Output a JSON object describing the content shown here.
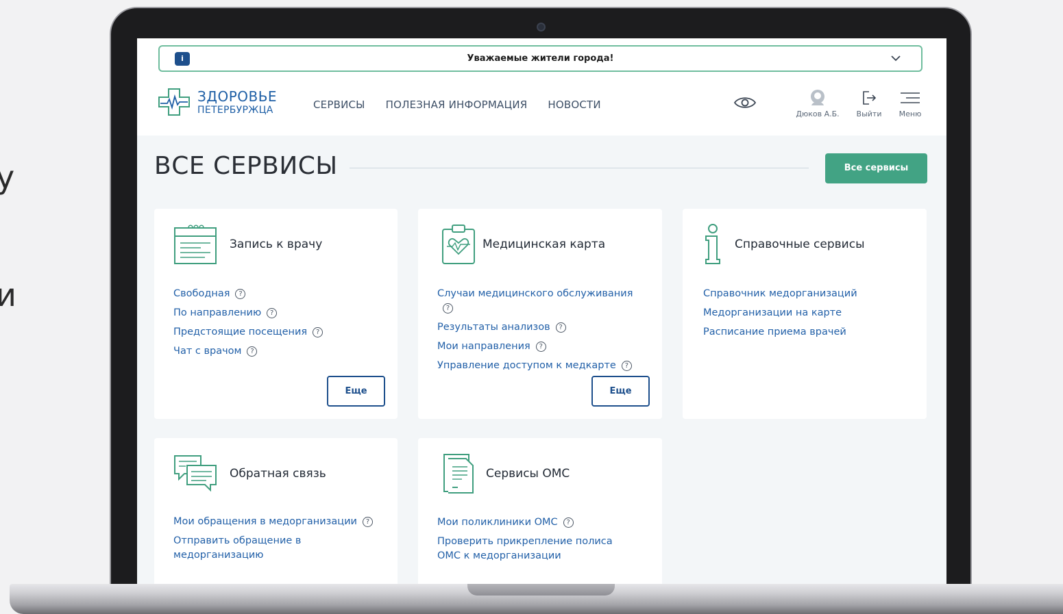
{
  "left_glyphs": [
    "у",
    "и"
  ],
  "alert": {
    "badge": "i",
    "text": "Уважаемые жители города!"
  },
  "logo": {
    "line1": "ЗДОРОВЬЕ",
    "line2": "ПЕТЕРБУРЖЦА"
  },
  "nav": [
    "СЕРВИСЫ",
    "ПОЛЕЗНАЯ ИНФОРМАЦИЯ",
    "НОВОСТИ"
  ],
  "header_actions": {
    "user": "Дюков А.Б.",
    "exit": "Выйти",
    "menu": "Меню"
  },
  "page": {
    "title": "ВСЕ СЕРВИСЫ",
    "all_services_button": "Все сервисы"
  },
  "cards": [
    {
      "title": "Запись к врачу",
      "icon": "calendar-icon",
      "links": [
        {
          "label": "Свободная",
          "help": true
        },
        {
          "label": "По направлению",
          "help": true
        },
        {
          "label": "Предстоящие посещения",
          "help": true
        },
        {
          "label": "Чат с врачом",
          "help": true
        }
      ],
      "more": "Еще"
    },
    {
      "title": "Медицинская карта",
      "icon": "medical-card-icon",
      "links": [
        {
          "label": "Случаи медицинского обслуживания",
          "help": true
        },
        {
          "label": "Результаты анализов",
          "help": true
        },
        {
          "label": "Мои направления",
          "help": true
        },
        {
          "label": "Управление доступом к медкарте",
          "help": true
        }
      ],
      "more": "Еще"
    },
    {
      "title": "Справочные сервисы",
      "icon": "info-icon",
      "links": [
        {
          "label": "Справочник медорганизаций",
          "help": false
        },
        {
          "label": "Медорганизации на карте",
          "help": false
        },
        {
          "label": "Расписание приема врачей",
          "help": false
        }
      ]
    },
    {
      "title": "Обратная связь",
      "icon": "chat-bubbles-icon",
      "links": [
        {
          "label": "Мои обращения в медорганизации",
          "help": true
        },
        {
          "label": "Отправить обращение в медорганизацию",
          "help": false
        }
      ]
    },
    {
      "title": "Сервисы ОМС",
      "icon": "document-icon",
      "links": [
        {
          "label": "Мои поликлиники ОМС",
          "help": true
        },
        {
          "label": "Проверить прикрепление полиса ОМС к медорганизации",
          "help": false
        }
      ]
    }
  ],
  "colors": {
    "brand_blue": "#1d5ea5",
    "link_blue": "#2260a8",
    "accent_green": "#42a384",
    "icon_green": "#3f9e7e",
    "alert_border": "#6fbd9e"
  }
}
